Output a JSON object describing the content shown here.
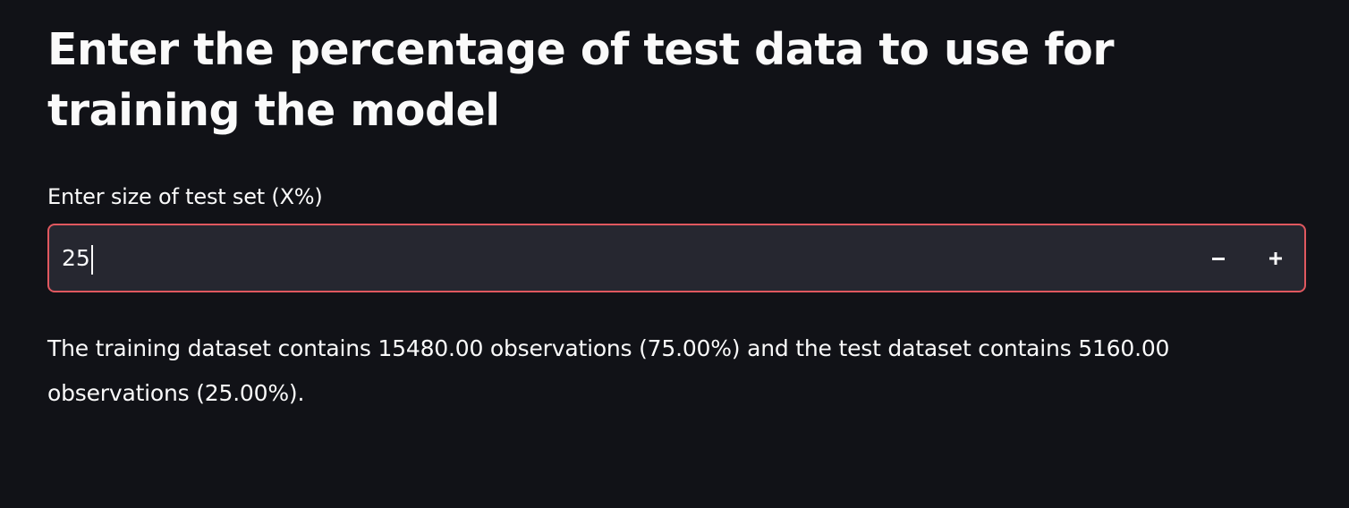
{
  "page": {
    "title": "Enter the percentage of test data to use for training the model"
  },
  "test_size_input": {
    "label": "Enter size of test set (X%)",
    "value": "25",
    "decrement_icon": "minus-icon",
    "increment_icon": "plus-icon"
  },
  "result": {
    "text": "The training dataset contains 15480.00 observations (75.00%) and the test dataset contains 5160.00 observations (25.00%)."
  },
  "colors": {
    "background": "#111217",
    "input_background": "#262730",
    "input_border_focus": "#e0585f",
    "text": "#fafafa"
  }
}
